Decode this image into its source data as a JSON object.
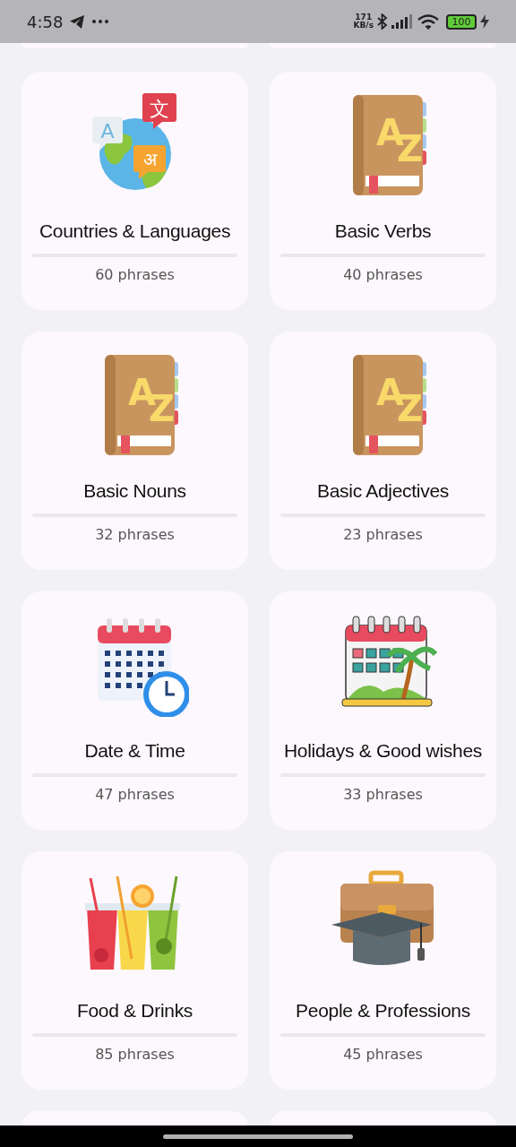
{
  "status_bar": {
    "time": "4:58",
    "speed_value": "171",
    "speed_unit": "KB/s",
    "battery": "100",
    "charging": true
  },
  "topics": [
    {
      "title": "Countries & Languages",
      "count": "60 phrases",
      "level": 0,
      "kind": "globe",
      "glyphs": [
        "A",
        "文",
        "अ"
      ]
    },
    {
      "title": "Basic Verbs",
      "count": "40 phrases",
      "level": 0,
      "kind": "book",
      "glyphs": [
        "A",
        "Z"
      ]
    },
    {
      "title": "Basic Nouns",
      "count": "32 phrases",
      "level": 0,
      "kind": "book",
      "glyphs": [
        "A",
        "Z"
      ]
    },
    {
      "title": "Basic Adjectives",
      "count": "23 phrases",
      "level": 0,
      "kind": "book",
      "glyphs": [
        "A",
        "Z"
      ]
    },
    {
      "title": "Date & Time",
      "count": "47 phrases",
      "level": 0,
      "kind": "calendar"
    },
    {
      "title": "Holidays & Good wishes",
      "count": "33 phrases",
      "level": 0,
      "kind": "holiday"
    },
    {
      "title": "Food & Drinks",
      "count": "85 phrases",
      "level": 0,
      "kind": "drinks"
    },
    {
      "title": "People & Professions",
      "count": "45 phrases",
      "level": 0,
      "kind": "briefcase"
    }
  ]
}
